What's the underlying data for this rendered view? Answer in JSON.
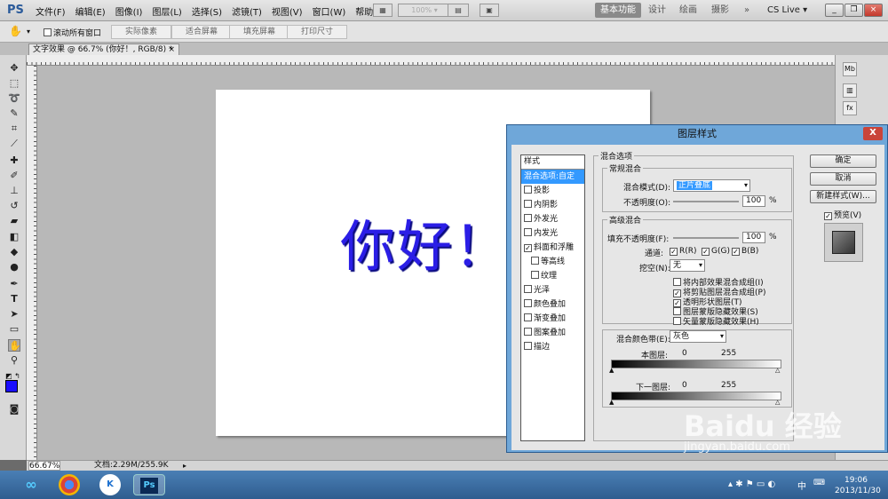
{
  "app": {
    "logo": "PS"
  },
  "menu": [
    "文件(F)",
    "编辑(E)",
    "图像(I)",
    "图层(L)",
    "选择(S)",
    "滤镜(T)",
    "视图(V)",
    "窗口(W)",
    "帮助(H)"
  ],
  "menubar": {
    "zoom": "100%",
    "workspaces": [
      "基本功能",
      "设计",
      "绘画",
      "摄影"
    ],
    "cs_live": "CS Live"
  },
  "options": {
    "scroll_all": "滚动所有窗口",
    "buttons": [
      "实际像素",
      "适合屏幕",
      "填充屏幕",
      "打印尺寸"
    ]
  },
  "doc_tab": {
    "title": "文字效果 @ 66.7% (你好！, RGB/8) *",
    "close": "×"
  },
  "canvas": {
    "text": "你好！",
    "text_color": "#2b1ee6"
  },
  "status": {
    "zoom": "66.67%",
    "doc_info": "文档:2.29M/255.9K"
  },
  "dialog": {
    "title": "图层样式",
    "close": "X",
    "styles_header": "样式",
    "styles": [
      {
        "label": "混合选项:自定",
        "checkbox": false,
        "selected": true,
        "checked": false,
        "indent": false
      },
      {
        "label": "投影",
        "checkbox": true,
        "checked": false,
        "indent": false
      },
      {
        "label": "内阴影",
        "checkbox": true,
        "checked": false,
        "indent": false
      },
      {
        "label": "外发光",
        "checkbox": true,
        "checked": false,
        "indent": false
      },
      {
        "label": "内发光",
        "checkbox": true,
        "checked": false,
        "indent": false
      },
      {
        "label": "斜面和浮雕",
        "checkbox": true,
        "checked": true,
        "indent": false
      },
      {
        "label": "等高线",
        "checkbox": true,
        "checked": false,
        "indent": true
      },
      {
        "label": "纹理",
        "checkbox": true,
        "checked": false,
        "indent": true
      },
      {
        "label": "光泽",
        "checkbox": true,
        "checked": false,
        "indent": false
      },
      {
        "label": "颜色叠加",
        "checkbox": true,
        "checked": false,
        "indent": false
      },
      {
        "label": "渐变叠加",
        "checkbox": true,
        "checked": false,
        "indent": false
      },
      {
        "label": "图案叠加",
        "checkbox": true,
        "checked": false,
        "indent": false
      },
      {
        "label": "描边",
        "checkbox": true,
        "checked": false,
        "indent": false
      }
    ],
    "blend_options": "混合选项",
    "general": {
      "title": "常规混合",
      "mode_label": "混合模式(D):",
      "mode_value": "正片叠底",
      "opacity_label": "不透明度(O):",
      "opacity_value": "100",
      "unit": "%"
    },
    "advanced": {
      "title": "高级混合",
      "fill_label": "填充不透明度(F):",
      "fill_value": "100",
      "unit": "%",
      "channels_label": "通道:",
      "channels": [
        "R(R)",
        "G(G)",
        "B(B)"
      ],
      "knockout_label": "挖空(N):",
      "knockout_value": "无",
      "options": [
        {
          "label": "将内部效果混合成组(I)",
          "checked": false
        },
        {
          "label": "将剪贴图层混合成组(P)",
          "checked": true
        },
        {
          "label": "透明形状图层(T)",
          "checked": true
        },
        {
          "label": "图层蒙版隐藏效果(S)",
          "checked": false
        },
        {
          "label": "矢量蒙版隐藏效果(H)",
          "checked": false
        }
      ]
    },
    "blend_if": {
      "label": "混合颜色带(E):",
      "value": "灰色",
      "this_layer": "本图层:",
      "underlying": "下一图层:",
      "low": "0",
      "high": "255"
    },
    "buttons": {
      "ok": "确定",
      "cancel": "取消",
      "new_style": "新建样式(W)...",
      "preview": "预览(V)"
    }
  },
  "taskbar": {
    "time": "19:06",
    "date": "2013/11/30",
    "ime": "中"
  },
  "watermark": {
    "brand": "Baidu 经验",
    "url": "jingyan.baidu.com"
  }
}
